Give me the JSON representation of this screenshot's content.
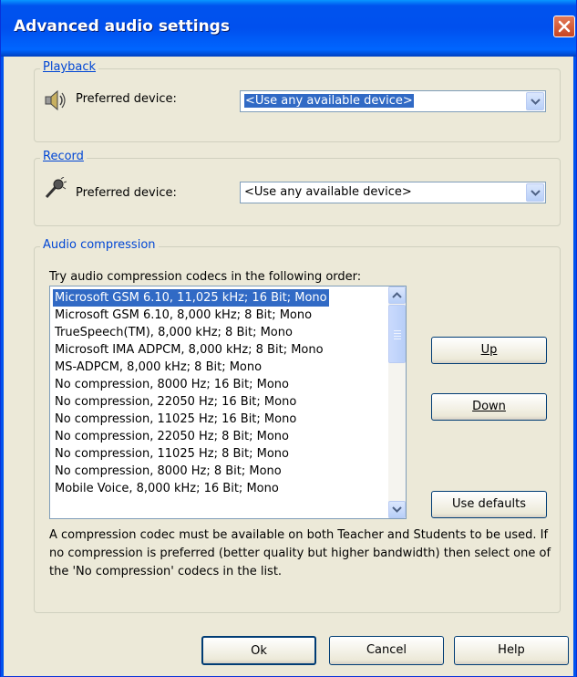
{
  "window": {
    "title": "Advanced audio settings"
  },
  "playback": {
    "legend": "Playback",
    "label": "Preferred device:",
    "selected": "<Use any available device>"
  },
  "record": {
    "legend": "Record",
    "label": "Preferred device:",
    "selected": "<Use any available device>"
  },
  "compression": {
    "legend": "Audio compression",
    "instruction": "Try audio compression codecs in the following order:",
    "codecs": [
      "Microsoft GSM 6.10, 11,025 kHz; 16 Bit; Mono",
      "Microsoft GSM 6.10, 8,000 kHz; 8 Bit; Mono",
      "TrueSpeech(TM), 8,000 kHz; 8 Bit; Mono",
      "Microsoft IMA ADPCM, 8,000 kHz; 8 Bit; Mono",
      "MS-ADPCM, 8,000 kHz; 8 Bit; Mono",
      "No compression, 8000 Hz; 16 Bit; Mono",
      "No compression, 22050 Hz; 16 Bit; Mono",
      "No compression, 11025 Hz; 16 Bit; Mono",
      "No compression, 22050 Hz; 8 Bit; Mono",
      "No compression, 11025 Hz; 8 Bit; Mono",
      "No compression, 8000 Hz; 8 Bit; Mono",
      "Mobile Voice, 8,000 kHz; 16 Bit; Mono"
    ],
    "selected_index": 0,
    "up_label": "Up",
    "down_label": "Down",
    "defaults_label": "Use defaults",
    "note": "A compression codec must be available on both Teacher and Students to be used. If no compression is preferred (better quality but higher bandwidth) then select one of the 'No compression' codecs in the list."
  },
  "buttons": {
    "ok": "Ok",
    "cancel": "Cancel",
    "help": "Help"
  },
  "colors": {
    "title_bar": "#0053ee",
    "selection": "#316ac5",
    "dialog_bg": "#ece9d8",
    "group_legend": "#0046d5"
  },
  "icons": [
    "close-icon",
    "speaker-icon",
    "microphone-icon",
    "chevron-down-icon",
    "scroll-up-icon",
    "scroll-down-icon"
  ]
}
